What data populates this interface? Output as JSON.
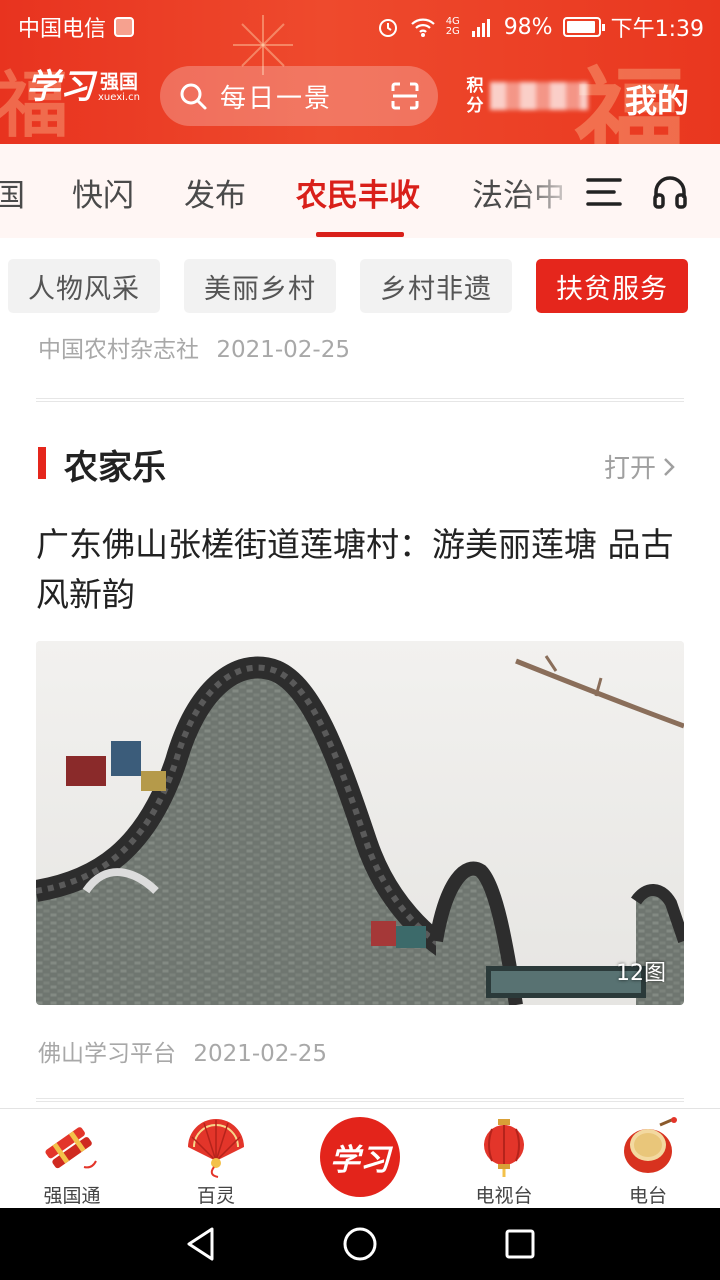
{
  "status_bar": {
    "carrier": "中国电信",
    "signal": "4G 2G",
    "battery": "98%",
    "time": "下午1:39"
  },
  "header": {
    "logo_script": "学习",
    "logo_main": "强国",
    "logo_sub": "xuexi.cn",
    "search_placeholder": "每日一景",
    "score_label": "积分",
    "mine_label": "我的"
  },
  "tabs": [
    {
      "label": "国",
      "active": false
    },
    {
      "label": "快闪",
      "active": false
    },
    {
      "label": "发布",
      "active": false
    },
    {
      "label": "农民丰收",
      "active": true
    },
    {
      "label": "法治中",
      "active": false
    }
  ],
  "chips": [
    {
      "label": "人物风采",
      "active": false
    },
    {
      "label": "美丽乡村",
      "active": false
    },
    {
      "label": "乡村非遗",
      "active": false
    },
    {
      "label": "扶贫服务",
      "active": true
    }
  ],
  "prev_article": {
    "source": "中国农村杂志社",
    "date": "2021-02-25"
  },
  "section": {
    "title": "农家乐",
    "open_label": "打开"
  },
  "article": {
    "headline": "广东佛山张槎街道莲塘村：游美丽莲塘 品古风新韵",
    "image_count": "12图",
    "source": "佛山学习平台",
    "date": "2021-02-25"
  },
  "bottom_nav": [
    {
      "label": "强国通"
    },
    {
      "label": "百灵"
    },
    {
      "label": "学习"
    },
    {
      "label": "电视台"
    },
    {
      "label": "电台"
    }
  ],
  "colors": {
    "brand_red": "#e5261c",
    "active_tab": "#d9201a",
    "meta_gray": "#a8a8a8"
  }
}
